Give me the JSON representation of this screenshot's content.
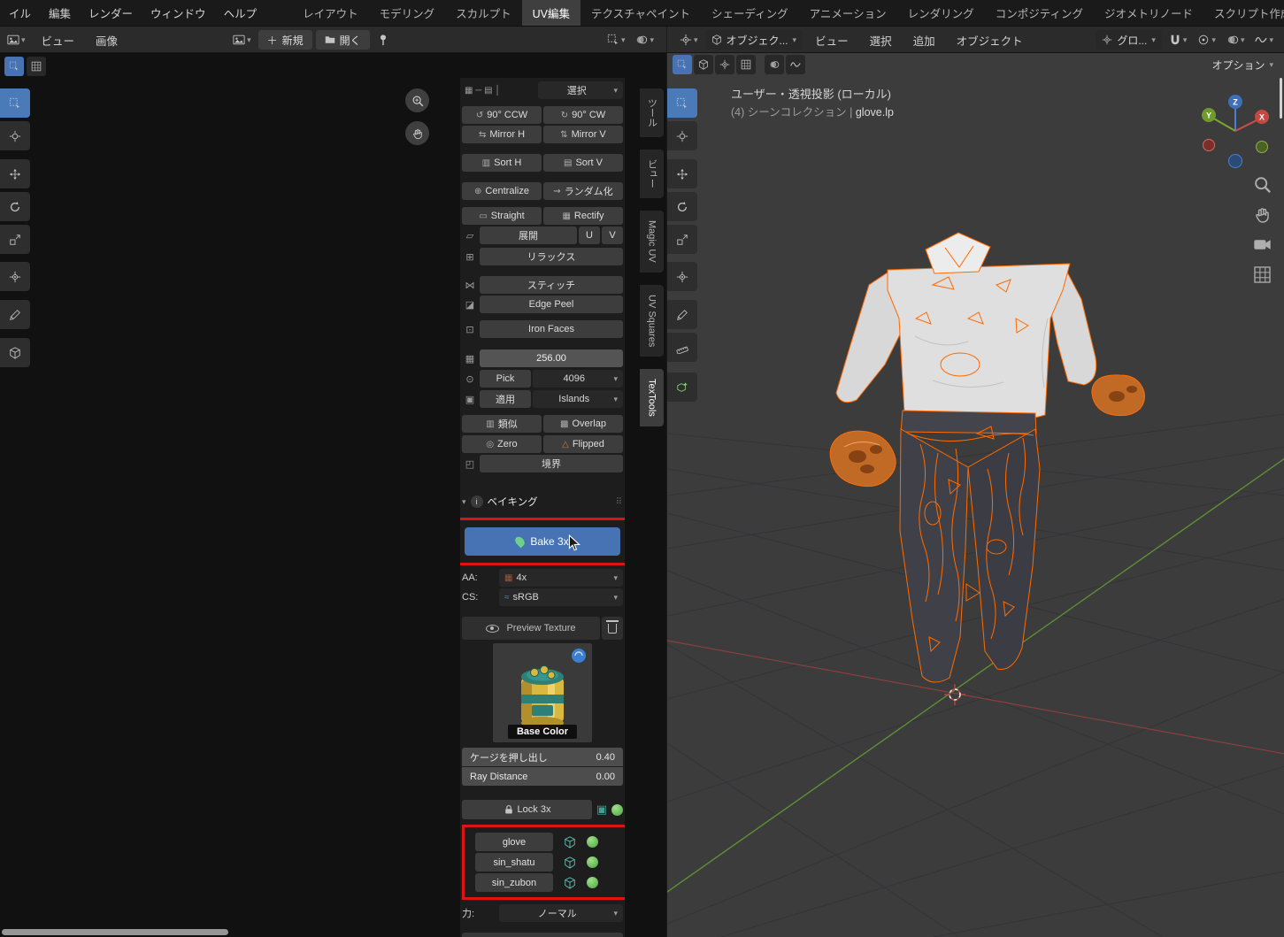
{
  "topbar": {
    "menus": [
      "イル",
      "編集",
      "レンダー",
      "ウィンドウ",
      "ヘルプ"
    ],
    "workspaces": [
      "レイアウト",
      "モデリング",
      "スカルプト",
      "UV編集",
      "テクスチャペイント",
      "シェーディング",
      "アニメーション",
      "レンダリング",
      "コンポジティング",
      "ジオメトリノード",
      "スクリプト作成"
    ]
  },
  "uv": {
    "header": {
      "menus": [
        "ビュー",
        "画像"
      ],
      "new_label": "新規",
      "open_label": "開く"
    },
    "panel": {
      "tabs": [
        "ツール",
        "ビュー",
        "Magic UV",
        "UV Squares",
        "TexTools"
      ],
      "select_label": "選択",
      "rotate_ccw": "90° CCW",
      "rotate_cw": "90° CW",
      "mirror_h": "Mirror H",
      "mirror_v": "Mirror V",
      "sort_h": "Sort H",
      "sort_v": "Sort V",
      "centralize": "Centralize",
      "randomize": "ランダム化",
      "straight": "Straight",
      "rectify": "Rectify",
      "unwrap": "展開",
      "u": "U",
      "v": "V",
      "relax": "リラックス",
      "stitch": "スティッチ",
      "edge_peel": "Edge Peel",
      "iron_faces": "Iron Faces",
      "texel_size": "256.00",
      "pick": "Pick",
      "pick_value": "4096",
      "apply": "適用",
      "apply_value": "Islands",
      "similar": "類似",
      "overlap": "Overlap",
      "zero": "Zero",
      "flipped": "Flipped",
      "boundary": "境界",
      "baking": {
        "title": "ベイキング",
        "bake_label": "Bake 3x",
        "aa_label": "AA:",
        "aa_value": "4x",
        "cs_label": "CS:",
        "cs_value": "sRGB",
        "preview_label": "Preview Texture",
        "texture_tag": "Base Color",
        "cage_label": "ケージを押し出し",
        "cage_value": "0.40",
        "ray_label": "Ray Distance",
        "ray_value": "0.00",
        "lock_label": "Lock 3x",
        "objects": [
          "glove",
          "sin_shatu",
          "sin_zubon"
        ],
        "force_label": "力:",
        "force_value": "ノーマル"
      }
    }
  },
  "vp": {
    "header": {
      "mode": "オブジェク...",
      "menus": [
        "ビュー",
        "選択",
        "追加",
        "オブジェクト"
      ],
      "orientation": "グロ...",
      "options": "オプション"
    },
    "overlay": {
      "line1": "ユーザー・透視投影 (ローカル)",
      "line2_prefix": "(4) シーンコレクション",
      "line2_sep": "|",
      "line2_object": "glove.lp"
    },
    "gizmo": {
      "x": "X",
      "y": "Y",
      "z": "Z"
    }
  },
  "colors": {
    "accent": "#4772b3",
    "annotation": "#dd1414",
    "wireframe": "#ff6a00"
  }
}
